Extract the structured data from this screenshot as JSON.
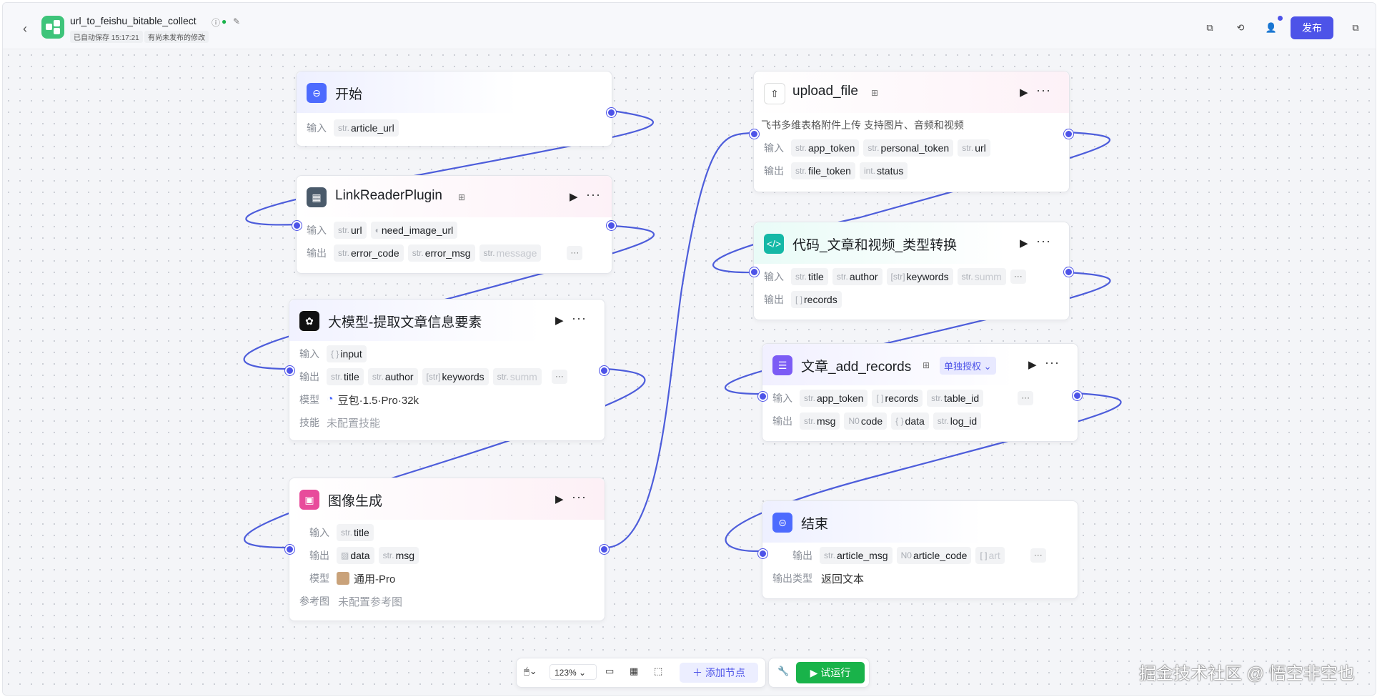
{
  "header": {
    "back_icon": "chevron-left-icon",
    "app_title": "url_to_feishu_bitable_collect",
    "save_status": "已自动保存 15:17:21",
    "unpublished": "有尚未发布的修改",
    "publish_label": "发布"
  },
  "nodes": {
    "start": {
      "title": "开始",
      "in_label": "输入",
      "inputs": [
        {
          "type": "str.",
          "name": "article_url"
        }
      ]
    },
    "link_reader": {
      "title": "LinkReaderPlugin",
      "in_label": "输入",
      "out_label": "输出",
      "inputs": [
        {
          "type": "str.",
          "name": "url"
        },
        {
          "type": "",
          "name": "need_image_url"
        }
      ],
      "outputs": [
        {
          "type": "str.",
          "name": "error_code"
        },
        {
          "type": "str.",
          "name": "error_msg"
        },
        {
          "type": "str.",
          "name": "message"
        }
      ]
    },
    "llm": {
      "title": "大模型-提取文章信息要素",
      "in_label": "输入",
      "out_label": "输出",
      "model_label": "模型",
      "skill_label": "技能",
      "inputs": [
        {
          "type": "{ }",
          "name": "input"
        }
      ],
      "outputs": [
        {
          "type": "str.",
          "name": "title"
        },
        {
          "type": "str.",
          "name": "author"
        },
        {
          "type": "[str]",
          "name": "keywords"
        },
        {
          "type": "str.",
          "name": "summ"
        }
      ],
      "model": "豆包·1.5·Pro·32k",
      "skill": "未配置技能"
    },
    "image_gen": {
      "title": "图像生成",
      "in_label": "输入",
      "out_label": "输出",
      "model_label": "模型",
      "ref_label": "参考图",
      "inputs": [
        {
          "type": "str.",
          "name": "title"
        }
      ],
      "outputs": [
        {
          "type": "img",
          "name": "data"
        },
        {
          "type": "str.",
          "name": "msg"
        }
      ],
      "model": "通用-Pro",
      "ref": "未配置参考图"
    },
    "upload_file": {
      "title": "upload_file",
      "description": "飞书多维表格附件上传 支持图片、音频和视频",
      "in_label": "输入",
      "out_label": "输出",
      "inputs": [
        {
          "type": "str.",
          "name": "app_token"
        },
        {
          "type": "str.",
          "name": "personal_token"
        },
        {
          "type": "str.",
          "name": "url"
        }
      ],
      "outputs": [
        {
          "type": "str.",
          "name": "file_token"
        },
        {
          "type": "int.",
          "name": "status"
        }
      ]
    },
    "code": {
      "title": "代码_文章和视频_类型转换",
      "in_label": "输入",
      "out_label": "输出",
      "inputs": [
        {
          "type": "str.",
          "name": "title"
        },
        {
          "type": "str.",
          "name": "author"
        },
        {
          "type": "[str]",
          "name": "keywords"
        },
        {
          "type": "str.",
          "name": "summ"
        }
      ],
      "outputs": [
        {
          "type": "[ ]",
          "name": "records"
        }
      ]
    },
    "add_records": {
      "title": "文章_add_records",
      "auth_badge": "单独授权",
      "in_label": "输入",
      "out_label": "输出",
      "inputs": [
        {
          "type": "str.",
          "name": "app_token"
        },
        {
          "type": "[ ]",
          "name": "records"
        },
        {
          "type": "str.",
          "name": "table_id"
        }
      ],
      "outputs": [
        {
          "type": "str.",
          "name": "msg"
        },
        {
          "type": "N0",
          "name": "code"
        },
        {
          "type": "{ }",
          "name": "data"
        },
        {
          "type": "str.",
          "name": "log_id"
        }
      ]
    },
    "end": {
      "title": "结束",
      "out_label": "输出",
      "type_label": "输出类型",
      "outputs": [
        {
          "type": "str.",
          "name": "article_msg"
        },
        {
          "type": "N0",
          "name": "article_code"
        },
        {
          "type": "[ ]",
          "name": "art"
        }
      ],
      "output_type": "返回文本"
    }
  },
  "toolbar": {
    "zoom": "123%",
    "add_node_label": "添加节点",
    "run_label": "试运行"
  },
  "watermark": "掘金技术社区 @ 悟空非空也",
  "colors": {
    "accent": "#4d53e8",
    "run_green": "#19b34a",
    "app_logo": "#3ec47a"
  }
}
